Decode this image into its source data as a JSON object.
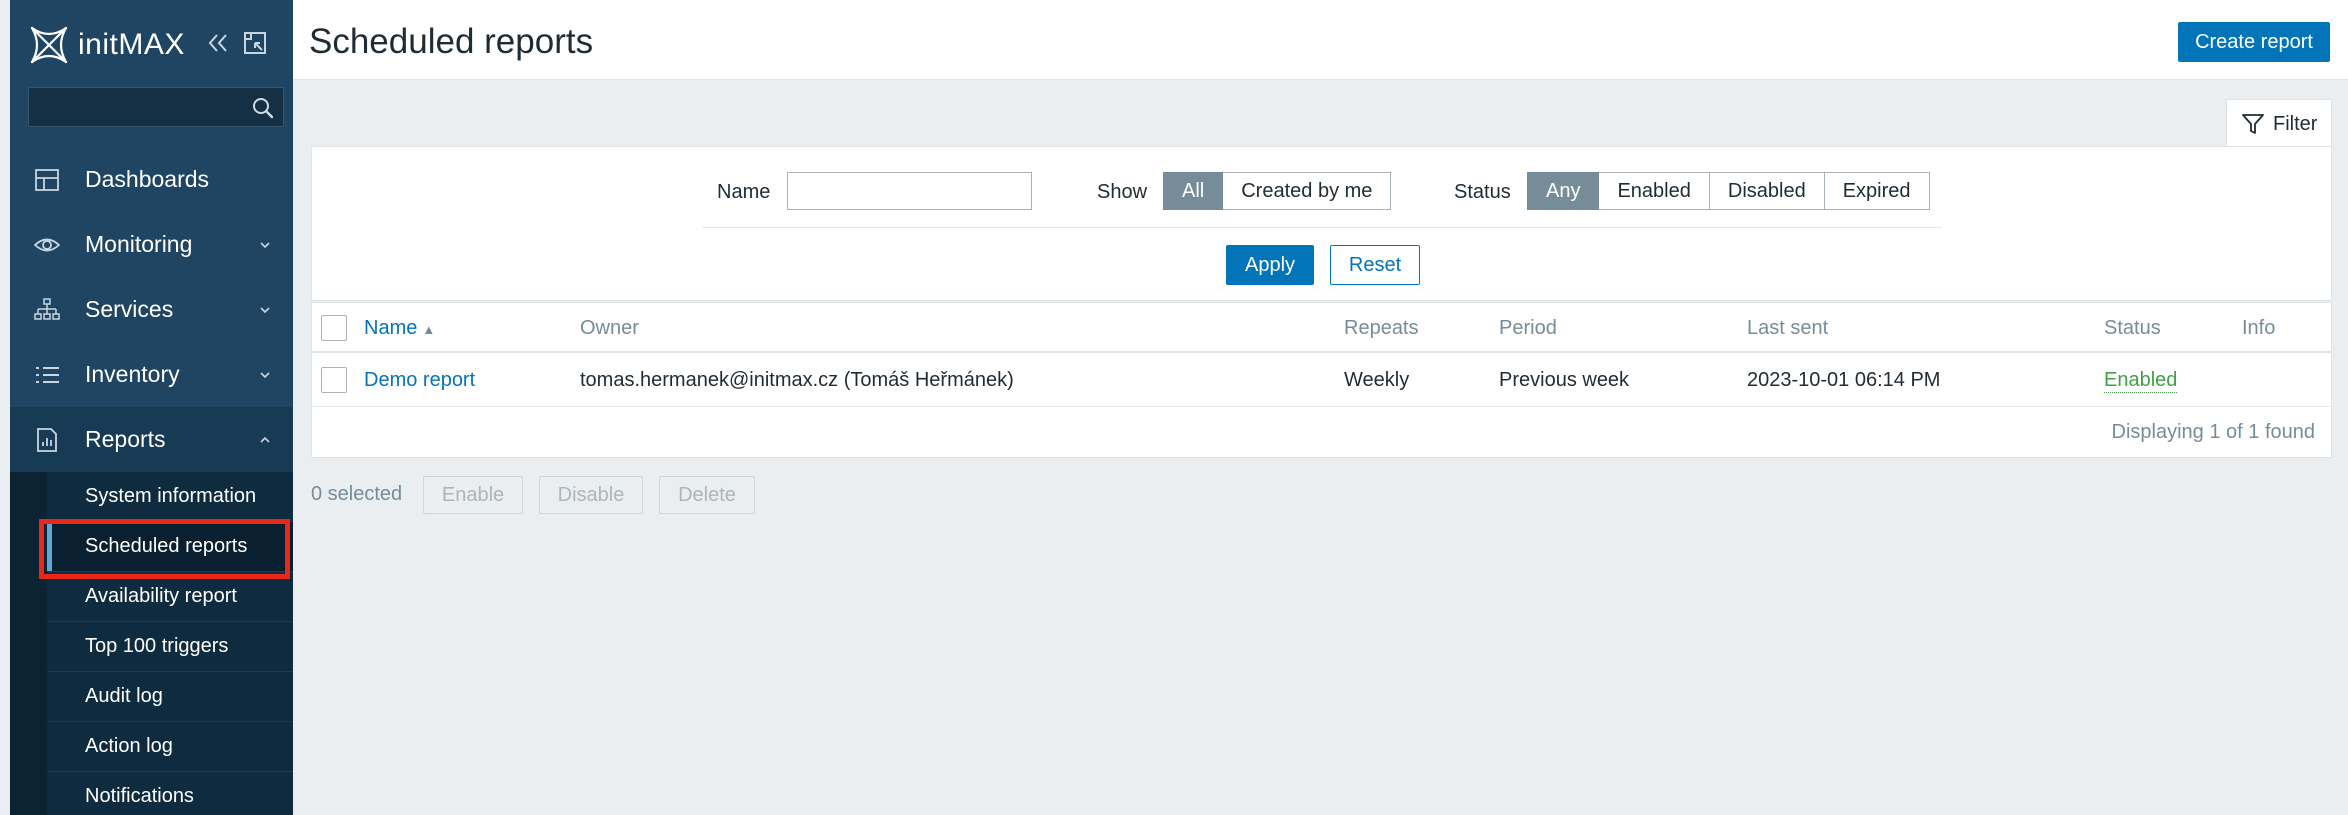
{
  "brand": {
    "name": "initMAX"
  },
  "sidebar": {
    "search_placeholder": "",
    "menu": [
      {
        "label": "Dashboards",
        "icon": "dashboards-icon"
      },
      {
        "label": "Monitoring",
        "icon": "eye-icon"
      },
      {
        "label": "Services",
        "icon": "services-icon"
      },
      {
        "label": "Inventory",
        "icon": "list-icon"
      },
      {
        "label": "Reports",
        "icon": "reports-icon"
      }
    ],
    "reports_submenu": [
      {
        "label": "System information"
      },
      {
        "label": "Scheduled reports",
        "active": true
      },
      {
        "label": "Availability report"
      },
      {
        "label": "Top 100 triggers"
      },
      {
        "label": "Audit log"
      },
      {
        "label": "Action log"
      },
      {
        "label": "Notifications"
      }
    ]
  },
  "header": {
    "title": "Scheduled reports",
    "create_button": "Create report"
  },
  "filter": {
    "tab_label": "Filter",
    "name_label": "Name",
    "name_value": "",
    "show_label": "Show",
    "show_options": [
      "All",
      "Created by me"
    ],
    "show_selected": "All",
    "status_label": "Status",
    "status_options": [
      "Any",
      "Enabled",
      "Disabled",
      "Expired"
    ],
    "status_selected": "Any",
    "apply": "Apply",
    "reset": "Reset"
  },
  "table": {
    "columns": [
      "Name",
      "Owner",
      "Repeats",
      "Period",
      "Last sent",
      "Status",
      "Info"
    ],
    "rows": [
      {
        "name": "Demo report",
        "owner": "tomas.hermanek@initmax.cz (Tomáš Heřmánek)",
        "repeats": "Weekly",
        "period": "Previous week",
        "last_sent": "2023-10-01 06:14 PM",
        "status": "Enabled",
        "info": ""
      }
    ],
    "footer": "Displaying 1 of 1 found"
  },
  "actions": {
    "selected": "0 selected",
    "enable": "Enable",
    "disable": "Disable",
    "delete": "Delete"
  },
  "colors": {
    "sidebar": "#1f4563",
    "primary": "#0275b8",
    "enabled": "#429e47",
    "highlight": "#e8281a"
  }
}
